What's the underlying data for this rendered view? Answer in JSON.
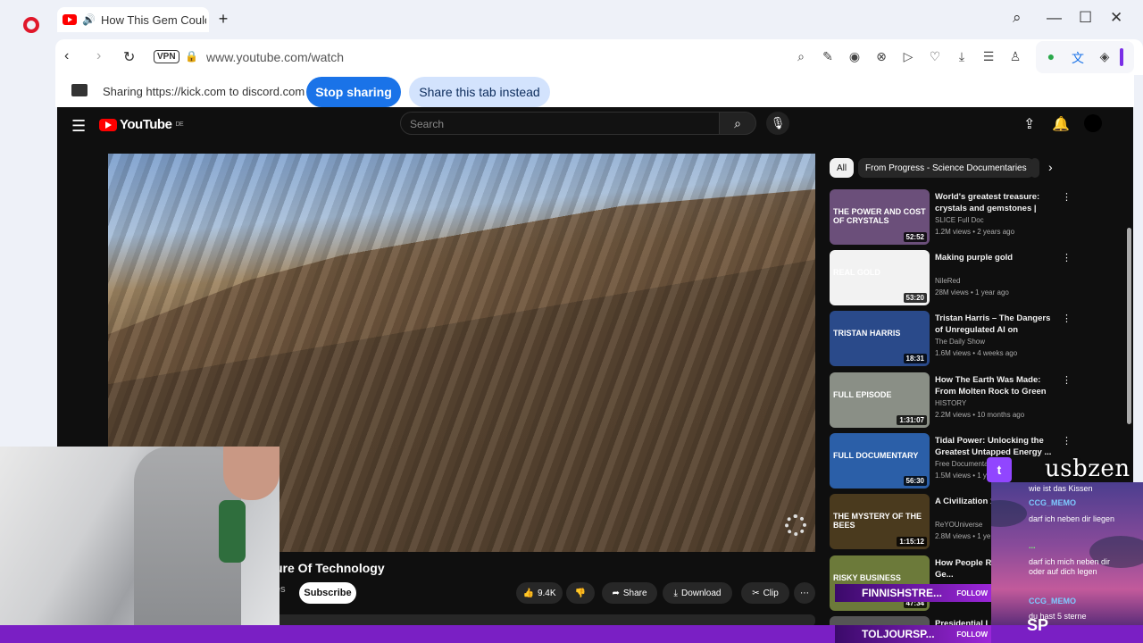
{
  "browser": {
    "tab_title": "How This Gem Could",
    "url": "www.youtube.com/watch",
    "vpn_label": "VPN"
  },
  "sharing": {
    "text": "Sharing https://kick.com to discord.com",
    "stop_label": "Stop sharing",
    "share_tab_label": "Share this tab instead"
  },
  "youtube": {
    "logo_text": "YouTube",
    "logo_region": "DE",
    "search_placeholder": "Search",
    "video_title_fragment": "ure Of Technology",
    "channel_fragment": "es",
    "subscribe_label": "Subscribe",
    "likes": "9.4K",
    "share_label": "Share",
    "download_label": "Download",
    "clip_label": "Clip",
    "chips": [
      "All",
      "From Progress - Science Documentaries"
    ],
    "recommendations": [
      {
        "title": "World's greatest treasure: crystals and gemstones | FULL...",
        "channel": "SLICE Full Doc",
        "meta": "1.2M views • 2 years ago",
        "duration": "52:52",
        "thumb_text": "THE POWER AND COST OF CRYSTALS",
        "thumb_color": "#6b4f7a"
      },
      {
        "title": "Making purple gold",
        "channel": "NileRed",
        "meta": "28M views • 1 year ago",
        "duration": "53:20",
        "thumb_text": "REAL GOLD",
        "thumb_color": "#f2f2f2"
      },
      {
        "title": "Tristan Harris – The Dangers of Unregulated AI on Humanity & ...",
        "channel": "The Daily Show",
        "meta": "1.6M views • 4 weeks ago",
        "duration": "18:31",
        "thumb_text": "TRISTAN HARRIS",
        "thumb_color": "#2a4a8a"
      },
      {
        "title": "How The Earth Was Made: From Molten Rock to Green Planet | ...",
        "channel": "HISTORY",
        "meta": "2.2M views • 10 months ago",
        "duration": "1:31:07",
        "thumb_text": "FULL EPISODE",
        "thumb_color": "#8a8f86"
      },
      {
        "title": "Tidal Power: Unlocking the Greatest Untapped Energy ...",
        "channel": "Free Documenta...",
        "meta": "1.5M views • 1 y...",
        "duration": "56:30",
        "thumb_text": "FULL DOCUMENTARY",
        "thumb_color": "#2b5fa8"
      },
      {
        "title": "A Civilization 1... Old",
        "channel": "ReYOUniverse",
        "meta": "2.8M views • 1 ye...",
        "duration": "1:15:12",
        "thumb_text": "THE MYSTERY OF THE BEES",
        "thumb_color": "#4a3a1e"
      },
      {
        "title": "How People Ris... Hunting For Ge...",
        "channel": "",
        "meta": "",
        "duration": "47:34",
        "thumb_text": "RISKY BUSINESS",
        "thumb_color": "#6c7a3a"
      },
      {
        "title": "Presidential Li...",
        "channel": "",
        "meta": "",
        "duration": "",
        "thumb_text": "",
        "thumb_color": "#555555"
      }
    ]
  },
  "twitch": {
    "streamer": "usbzen",
    "messages": [
      {
        "user": "",
        "text": "wie ist das Kissen"
      },
      {
        "user": "CCG_MEMO",
        "text": "darf ich neben dir liegen"
      },
      {
        "user": "...",
        "text": "darf ich mich neben dir oder auf dich legen"
      },
      {
        "user": "CCG_MEMO",
        "text": "du hast 5 sterne"
      }
    ],
    "alerts": [
      {
        "name": "FINNISHSTRE...",
        "action": "FOLLOW"
      },
      {
        "name": "TOLJOURSP...",
        "action": "FOLLOW"
      }
    ],
    "badge": "SP"
  }
}
